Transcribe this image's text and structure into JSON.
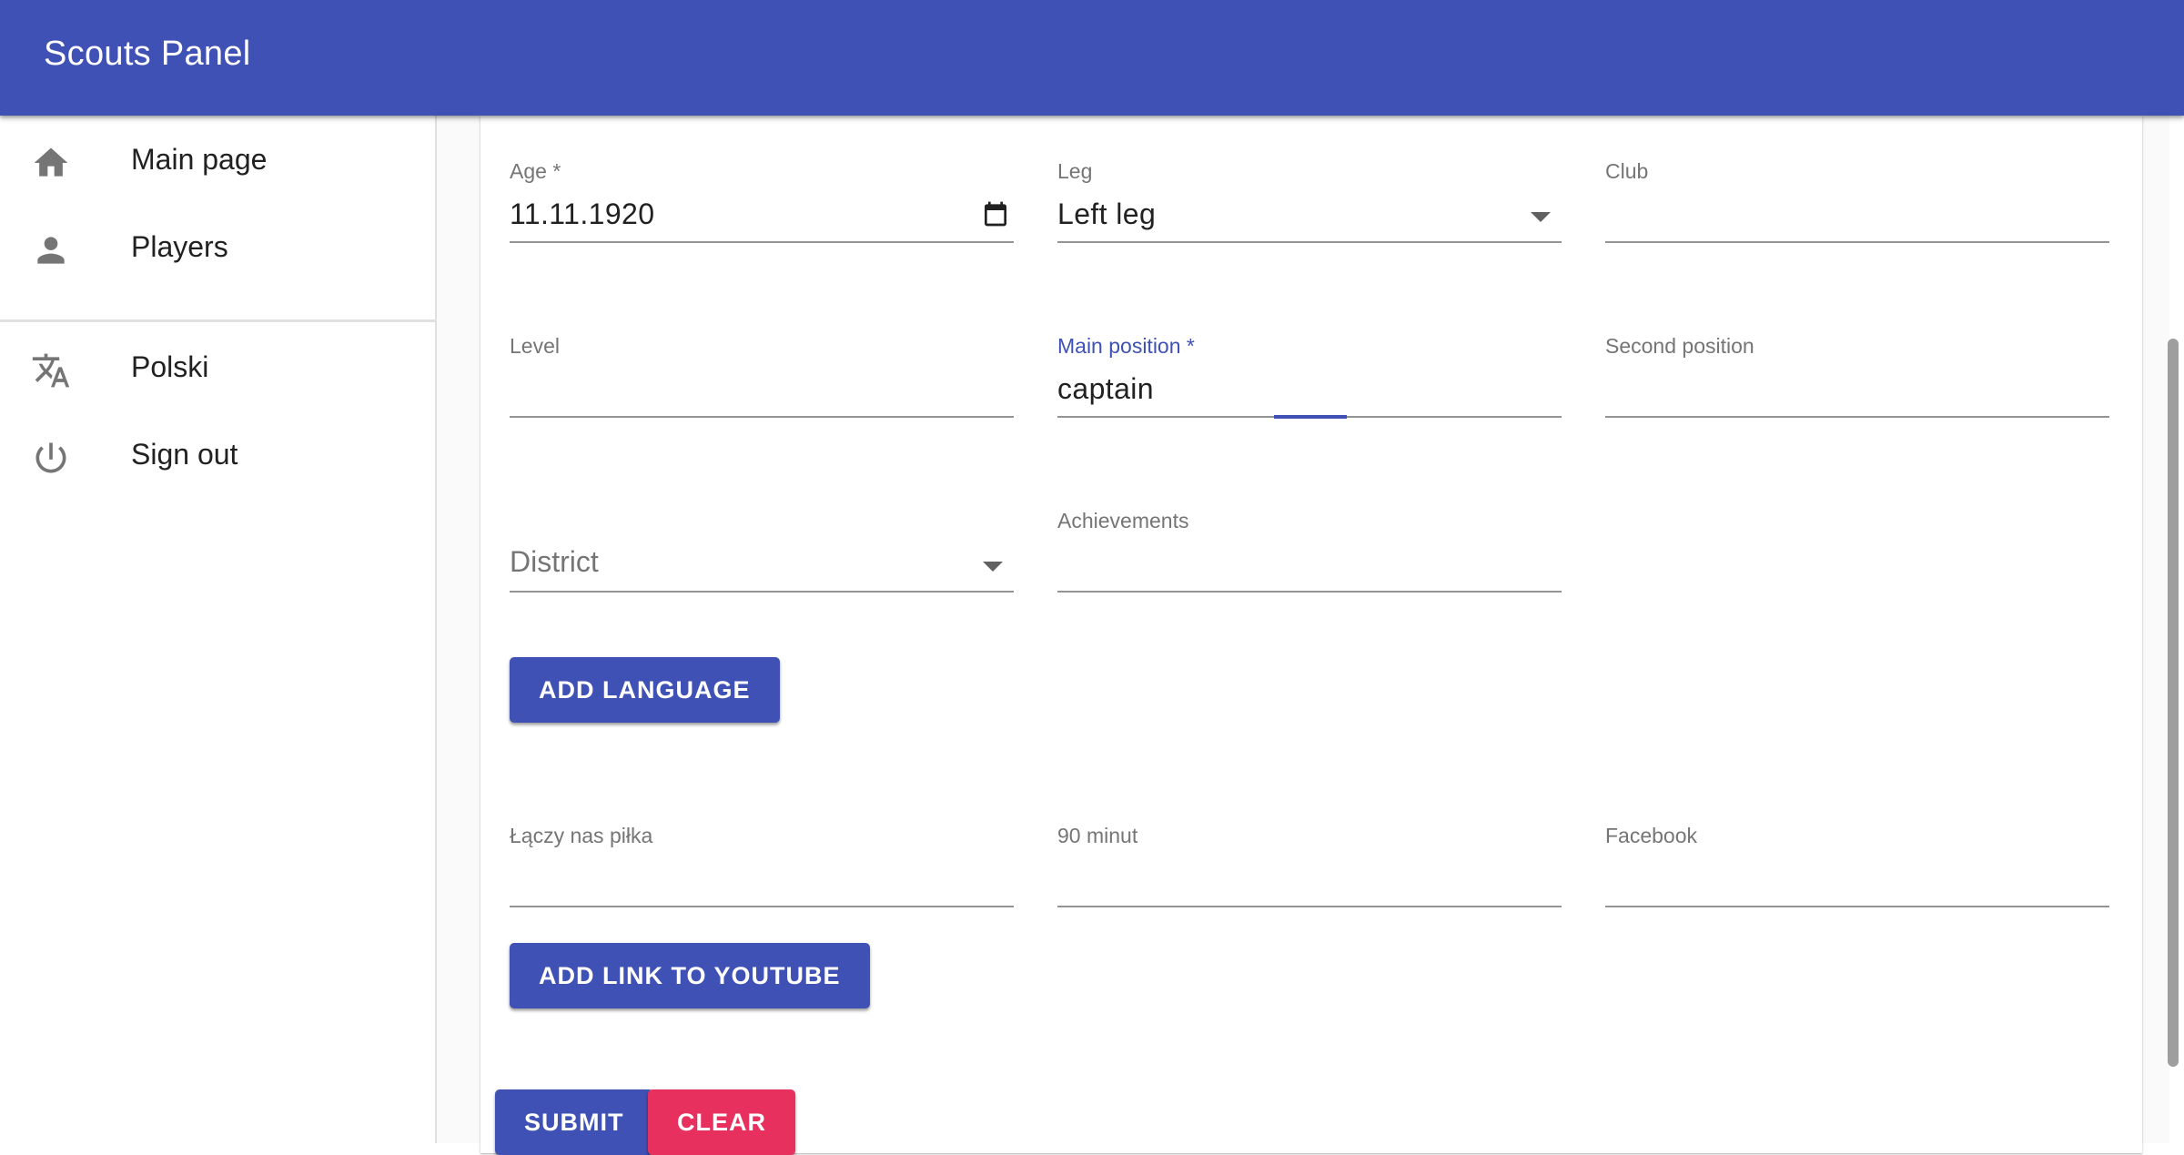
{
  "appbar": {
    "title": "Scouts Panel"
  },
  "drawer": {
    "items": [
      {
        "label": "Main page",
        "icon": "home-icon"
      },
      {
        "label": "Players",
        "icon": "person-icon"
      },
      {
        "label": "Polski",
        "icon": "translate-icon"
      },
      {
        "label": "Sign out",
        "icon": "power-icon"
      }
    ]
  },
  "form": {
    "age": {
      "label": "Age *",
      "value": "11.11.1920"
    },
    "leg": {
      "label": "Leg",
      "value": "Left leg"
    },
    "club": {
      "label": "Club",
      "value": ""
    },
    "level": {
      "label": "Level",
      "value": ""
    },
    "main_position": {
      "label": "Main position *",
      "value": "captain"
    },
    "second_position": {
      "label": "Second position",
      "value": ""
    },
    "district": {
      "placeholder": "District"
    },
    "achievements": {
      "label": "Achievements",
      "value": ""
    },
    "add_language_label": "ADD LANGUAGE",
    "laczy_nas_pilka": {
      "label": "Łączy nas piłka",
      "value": ""
    },
    "ninety_minut": {
      "label": "90 minut",
      "value": ""
    },
    "facebook": {
      "label": "Facebook",
      "value": ""
    },
    "add_youtube_label": "ADD LINK TO YOUTUBE",
    "submit_label": "SUBMIT",
    "clear_label": "CLEAR"
  },
  "colors": {
    "primary": "#3f51b5",
    "secondary": "#e8305f"
  }
}
